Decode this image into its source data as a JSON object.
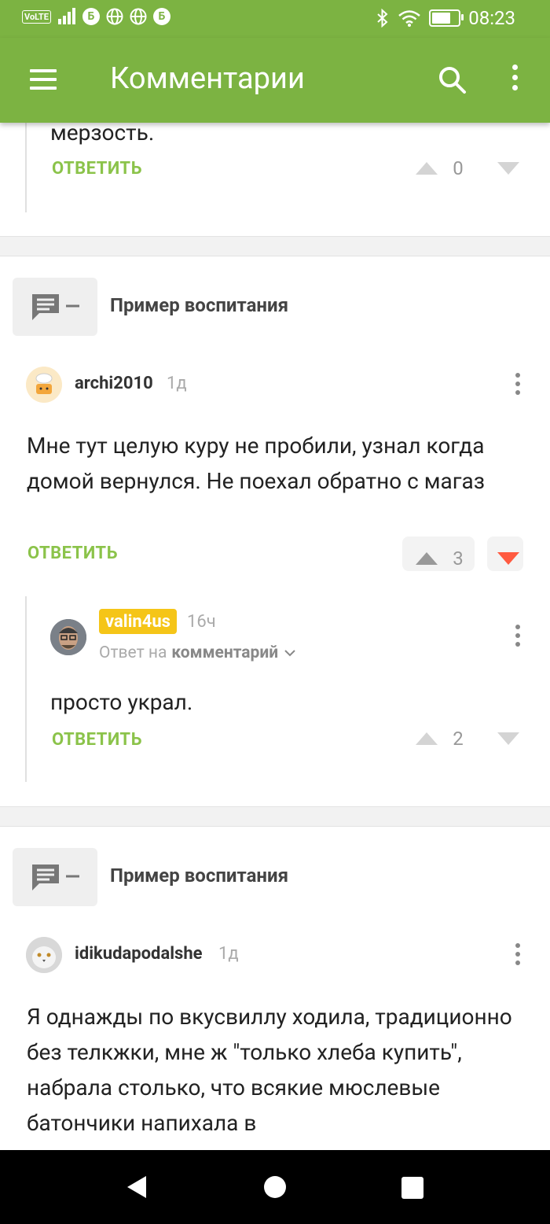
{
  "status_bar": {
    "volte": "VoLTE",
    "b1": "Б",
    "b2": "Б",
    "time": "08:23",
    "battery_level": 0.8
  },
  "toolbar": {
    "title": "Комментарии",
    "icons": [
      "menu-icon",
      "search-icon",
      "more-vertical-icon"
    ]
  },
  "top_comment": {
    "text_tail": "мерзость.",
    "reply_label": "ОТВЕТИТЬ",
    "votes": "0"
  },
  "post1": {
    "title": "Пример воспитания",
    "comment": {
      "user": "archi2010",
      "time": "1д",
      "text": "Мне тут целую куру не пробили, узнал когда домой вернулся. Не поехал обратно с магаз",
      "reply_label": "ОТВЕТИТЬ",
      "votes": "3"
    },
    "reply": {
      "user": "valin4us",
      "time": "16ч",
      "reply_to_prefix": "Ответ на",
      "reply_to_target": "комментарий",
      "text": "просто украл.",
      "reply_label": "ОТВЕТИТЬ",
      "votes": "2"
    }
  },
  "post2": {
    "title": "Пример воспитания",
    "comment": {
      "user": "idikudapodalshe",
      "time": "1д",
      "text": "Я однажды по вкусвиллу ходила, традиционно без телкжки, мне ж \"только хлеба купить\", набрала столько, что всякие мюслевые батончики напихала в"
    }
  },
  "colors": {
    "accent": "#7cb342",
    "reply_green": "#8bc34a",
    "downvote_red": "#ff5a40",
    "badge_yellow": "#f5c518"
  }
}
